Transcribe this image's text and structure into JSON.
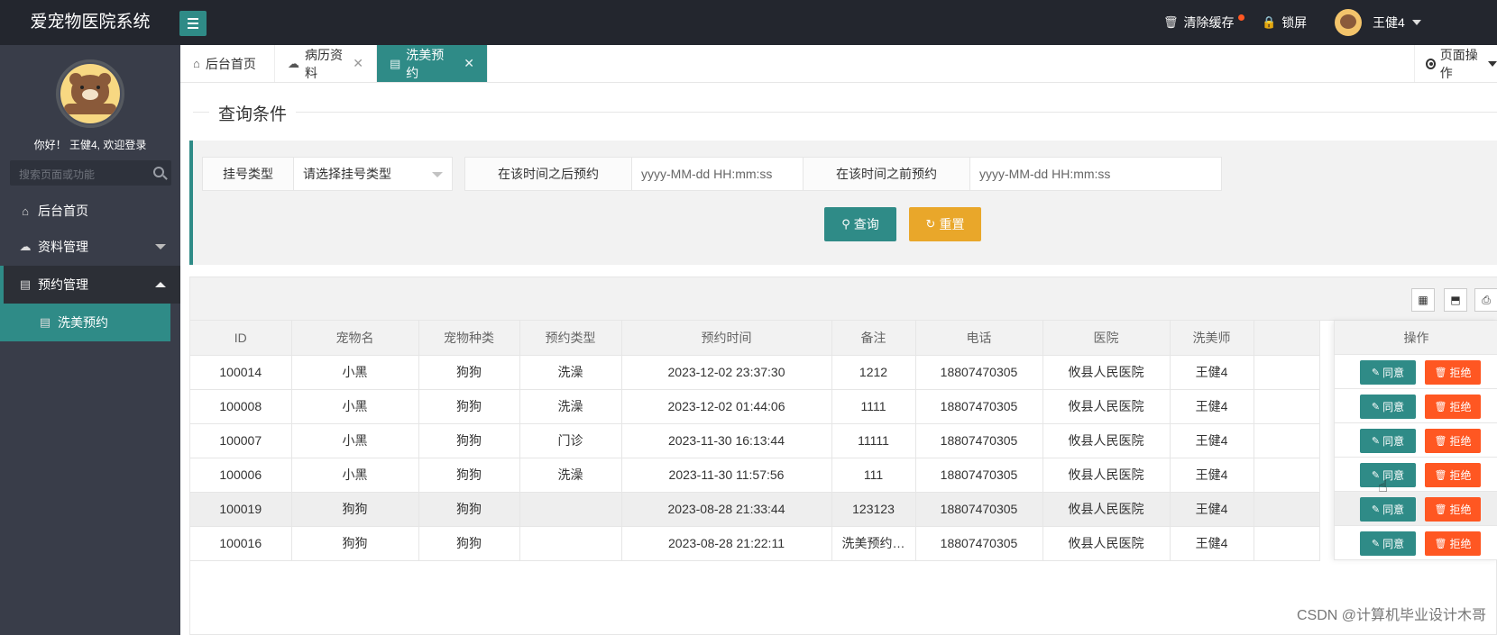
{
  "header": {
    "logo": "爱宠物医院系统",
    "clear_cache": "清除缓存",
    "lock": "锁屏",
    "user": "王健4"
  },
  "sidebar": {
    "welcome": "你好！ 王健4, 欢迎登录",
    "search_placeholder": "搜索页面或功能",
    "items": [
      {
        "label": "后台首页"
      },
      {
        "label": "资料管理"
      },
      {
        "label": "预约管理"
      },
      {
        "label": "洗美预约"
      }
    ]
  },
  "tabs": [
    {
      "label": "后台首页"
    },
    {
      "label": "病历资料"
    },
    {
      "label": "洗美预约"
    }
  ],
  "tab_actions": "页面操作",
  "query": {
    "title": "查询条件",
    "type_label": "挂号类型",
    "type_placeholder": "请选择挂号类型",
    "after_label": "在该时间之后预约",
    "after_placeholder": "yyyy-MM-dd HH:mm:ss",
    "before_label": "在该时间之前预约",
    "before_placeholder": "yyyy-MM-dd HH:mm:ss",
    "search_btn": "查询",
    "reset_btn": "重置"
  },
  "table": {
    "columns": [
      "ID",
      "宠物名",
      "宠物种类",
      "预约类型",
      "预约时间",
      "备注",
      "电话",
      "医院",
      "洗美师"
    ],
    "ops_header": "操作",
    "agree_label": "同意",
    "refuse_label": "拒绝",
    "rows": [
      {
        "id": "100014",
        "pet": "小黑",
        "species": "狗狗",
        "type": "洗澡",
        "time": "2023-12-02 23:37:30",
        "note": "1212",
        "phone": "18807470305",
        "hospital": "攸县人民医院",
        "groomer": "王健4"
      },
      {
        "id": "100008",
        "pet": "小黑",
        "species": "狗狗",
        "type": "洗澡",
        "time": "2023-12-02 01:44:06",
        "note": "1111",
        "phone": "18807470305",
        "hospital": "攸县人民医院",
        "groomer": "王健4"
      },
      {
        "id": "100007",
        "pet": "小黑",
        "species": "狗狗",
        "type": "门诊",
        "time": "2023-11-30 16:13:44",
        "note": "11111",
        "phone": "18807470305",
        "hospital": "攸县人民医院",
        "groomer": "王健4"
      },
      {
        "id": "100006",
        "pet": "小黑",
        "species": "狗狗",
        "type": "洗澡",
        "time": "2023-11-30 11:57:56",
        "note": "111",
        "phone": "18807470305",
        "hospital": "攸县人民医院",
        "groomer": "王健4"
      },
      {
        "id": "100019",
        "pet": "狗狗",
        "species": "狗狗",
        "type": "",
        "time": "2023-08-28 21:33:44",
        "note": "123123",
        "phone": "18807470305",
        "hospital": "攸县人民医院",
        "groomer": "王健4"
      },
      {
        "id": "100016",
        "pet": "狗狗",
        "species": "狗狗",
        "type": "",
        "time": "2023-08-28 21:22:11",
        "note": "洗美预约…",
        "phone": "18807470305",
        "hospital": "攸县人民医院",
        "groomer": "王健4"
      }
    ]
  },
  "watermark": "CSDN @计算机毕业设计木哥",
  "colors": {
    "header_bg": "#23262e",
    "sidebar_bg": "#393d49",
    "accent": "#2f8b87",
    "warn": "#e9a72a",
    "danger": "#ff5722"
  }
}
